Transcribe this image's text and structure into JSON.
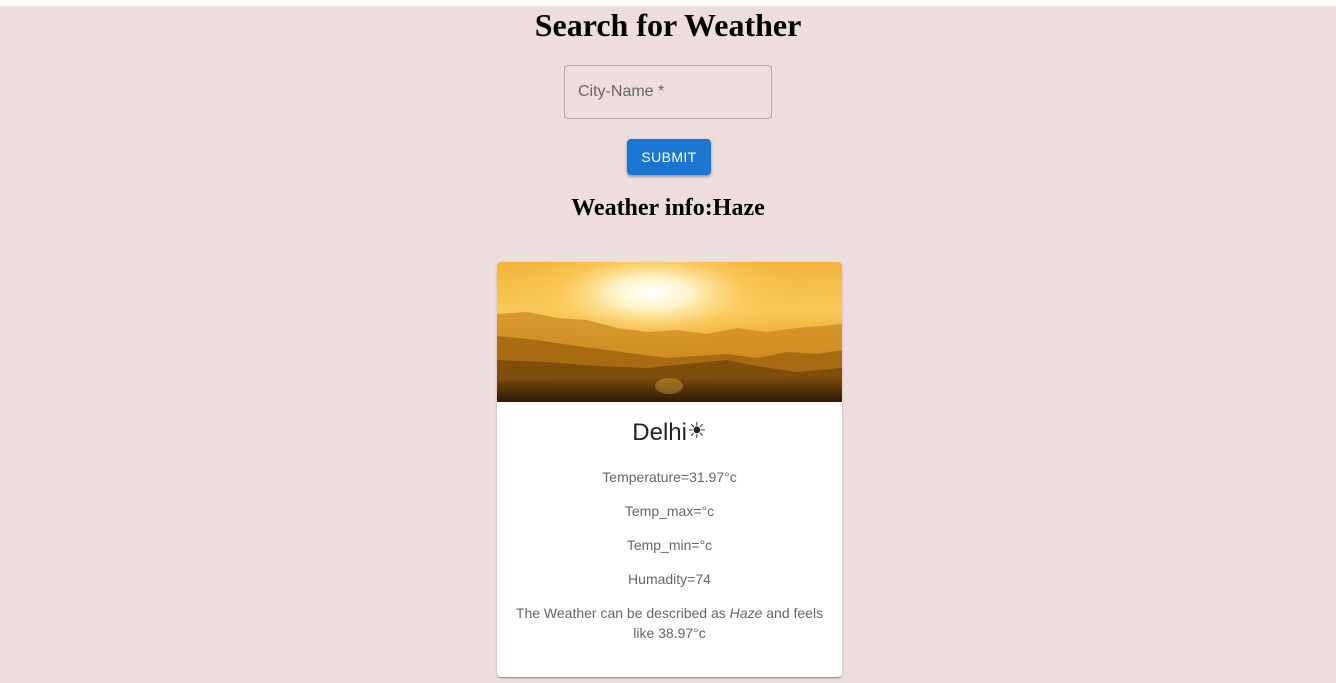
{
  "header": {
    "title": "Search for Weather"
  },
  "search": {
    "placeholder": "City-Name *",
    "value": "",
    "submit_label": "SUBMIT"
  },
  "weather_info": {
    "label": "Weather info:",
    "condition": "Haze"
  },
  "card": {
    "image_alt": "sunset-hills",
    "city": "Delhi",
    "weather_icon": "sun-icon",
    "weather_icon_glyph": "☀",
    "temperature": "Temperature=31.97°c",
    "temp_max": "Temp_max=°c",
    "temp_min": "Temp_min=°c",
    "humidity": "Humadity=74",
    "description_prefix": "The Weather can be described as ",
    "description_condition": "Haze",
    "description_suffix": " and feels like 38.97°c"
  },
  "colors": {
    "page_background": "#eedddd",
    "primary_button": "#1976d2",
    "card_background": "#ffffff",
    "secondary_text": "#666666"
  }
}
